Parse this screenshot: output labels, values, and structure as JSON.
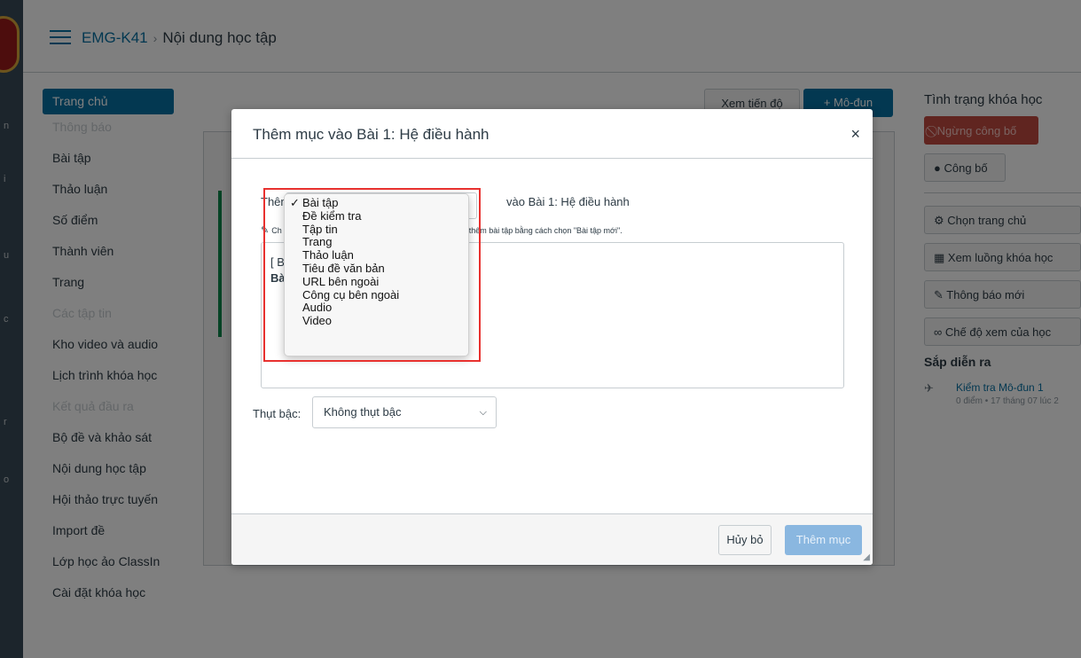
{
  "breadcrumb": {
    "course": "EMG-K41",
    "page": "Nội dung học tập"
  },
  "course_nav": [
    {
      "label": "Trang chủ",
      "state": "active"
    },
    {
      "label": "Thông báo",
      "state": "disabled"
    },
    {
      "label": "Bài tập",
      "state": "normal"
    },
    {
      "label": "Thảo luận",
      "state": "normal"
    },
    {
      "label": "Số điểm",
      "state": "normal"
    },
    {
      "label": "Thành viên",
      "state": "normal"
    },
    {
      "label": "Trang",
      "state": "normal"
    },
    {
      "label": "Các tập tin",
      "state": "disabled"
    },
    {
      "label": "Kho video và audio",
      "state": "normal"
    },
    {
      "label": "Lịch trình khóa học",
      "state": "normal"
    },
    {
      "label": "Kết quả đầu ra",
      "state": "disabled"
    },
    {
      "label": "Bộ đề và khảo sát",
      "state": "normal"
    },
    {
      "label": "Nội dung học tập",
      "state": "normal"
    },
    {
      "label": "Hội thảo trực tuyến",
      "state": "normal"
    },
    {
      "label": "Import đề",
      "state": "normal"
    },
    {
      "label": "Lớp học ảo ClassIn",
      "state": "normal"
    },
    {
      "label": "Cài đặt khóa học",
      "state": "normal"
    }
  ],
  "toolbar": {
    "progress_label": "Xem tiến độ",
    "module_label": "+ Mô-đun"
  },
  "sidebar": {
    "status_title": "Tình trạng khóa học",
    "unpublish_label": "Ngừng công bố",
    "publish_label": "Công bố",
    "actions": [
      "Chọn trang chủ",
      "Xem luồng khóa học",
      "Thông báo mới",
      "Chế độ xem của học"
    ],
    "upcoming_title": "Sắp diễn ra",
    "upcoming_item": "Kiểm tra Mô-đun 1",
    "upcoming_meta": "0 điểm • 17 tháng 07 lúc 2"
  },
  "dialog": {
    "title": "Thêm mục vào Bài 1: Hệ điều hành",
    "close_label": "×",
    "add_prefix": "Thêm",
    "add_suffix": "vào Bài 1: Hệ điều hành",
    "hint_prefix": "Ch",
    "hint_text": ", hoặc thêm bài tập bằng cách chọn \"Bài tập mới\".",
    "list_line1": "[ B",
    "list_line2": "Bà",
    "indent_label": "Thụt bậc:",
    "indent_value": "Không thụt bậc",
    "cancel_label": "Hủy bỏ",
    "submit_label": "Thêm mục"
  },
  "dropdown": {
    "selected": "Bài tập",
    "check_mark": "✓",
    "options": [
      "Bài tập",
      "Đề kiểm tra",
      "Tập tin",
      "Trang",
      "Thảo luận",
      "Tiêu đề văn bản",
      "URL bên ngoài",
      "Công cụ bên ngoài",
      "Audio",
      "Video"
    ]
  },
  "colors": {
    "brand": "#0770a3",
    "danger": "#c04a40",
    "highlight": "#e8312f",
    "success": "#0b874b"
  }
}
